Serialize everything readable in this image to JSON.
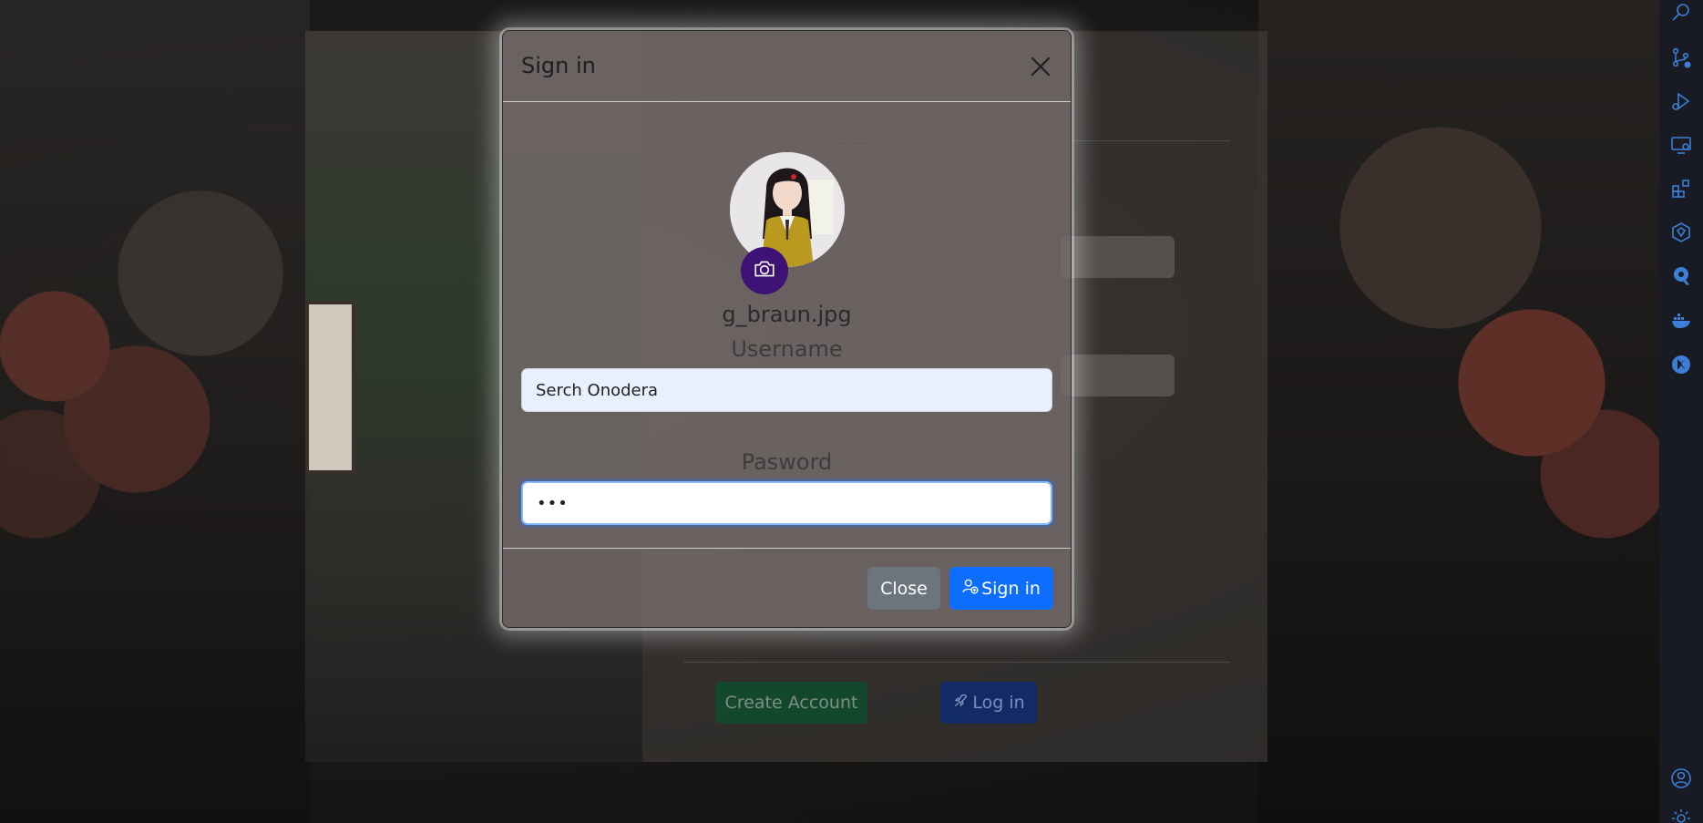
{
  "modal": {
    "title": "Sign in",
    "file_name": "g_braun.jpg",
    "username_label": "Username",
    "username_value": "Serch Onodera",
    "password_label": "Pasword",
    "password_value": "•••",
    "close_label": "Close",
    "signin_label": "Sign in",
    "icons": {
      "close": "x-icon",
      "camera": "camera-icon",
      "signin": "person-add-icon"
    },
    "colors": {
      "primary": "#0d6efd",
      "secondary": "#6c757d",
      "camera_button": "#3e1174"
    }
  },
  "background_page": {
    "create_account_label": "Create Account",
    "login_label": "Log in",
    "colors": {
      "create_account": "#14482e",
      "login": "#122a66"
    }
  },
  "activity_bar": {
    "icons": [
      "search-icon",
      "source-control-icon",
      "run-debug-icon",
      "remote-explorer-icon",
      "extensions-icon",
      "kubernetes-icon",
      "docker-registry-icon",
      "docker-icon",
      "kotlin-icon",
      "account-icon",
      "settings-gear-icon"
    ],
    "accent_color": "#3c7fd6"
  }
}
